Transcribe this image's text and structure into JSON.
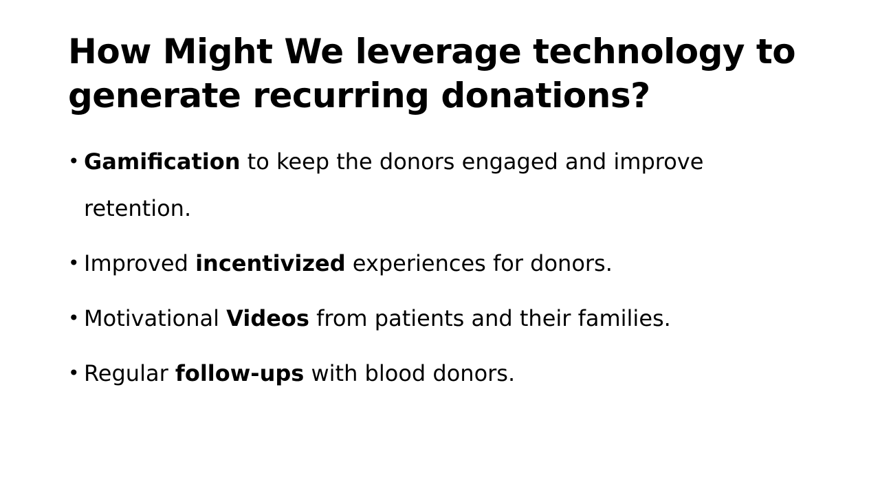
{
  "slide": {
    "title_lines": [
      "How Might We leverage technology to",
      "generate recurring donations?"
    ],
    "bullet_symbol": "•",
    "bullets": [
      {
        "pre": "",
        "bold": "Gamification",
        "post": " to keep the donors engaged and improve retention."
      },
      {
        "pre": "Improved ",
        "bold": "incentivized",
        "post": " experiences for donors."
      },
      {
        "pre": "Motivational ",
        "bold": "Videos",
        "post": " from patients and their families."
      },
      {
        "pre": "Regular ",
        "bold": "follow-ups",
        "post": " with blood donors."
      }
    ]
  },
  "colors": {
    "background": "#ffffff",
    "text": "#000000"
  }
}
